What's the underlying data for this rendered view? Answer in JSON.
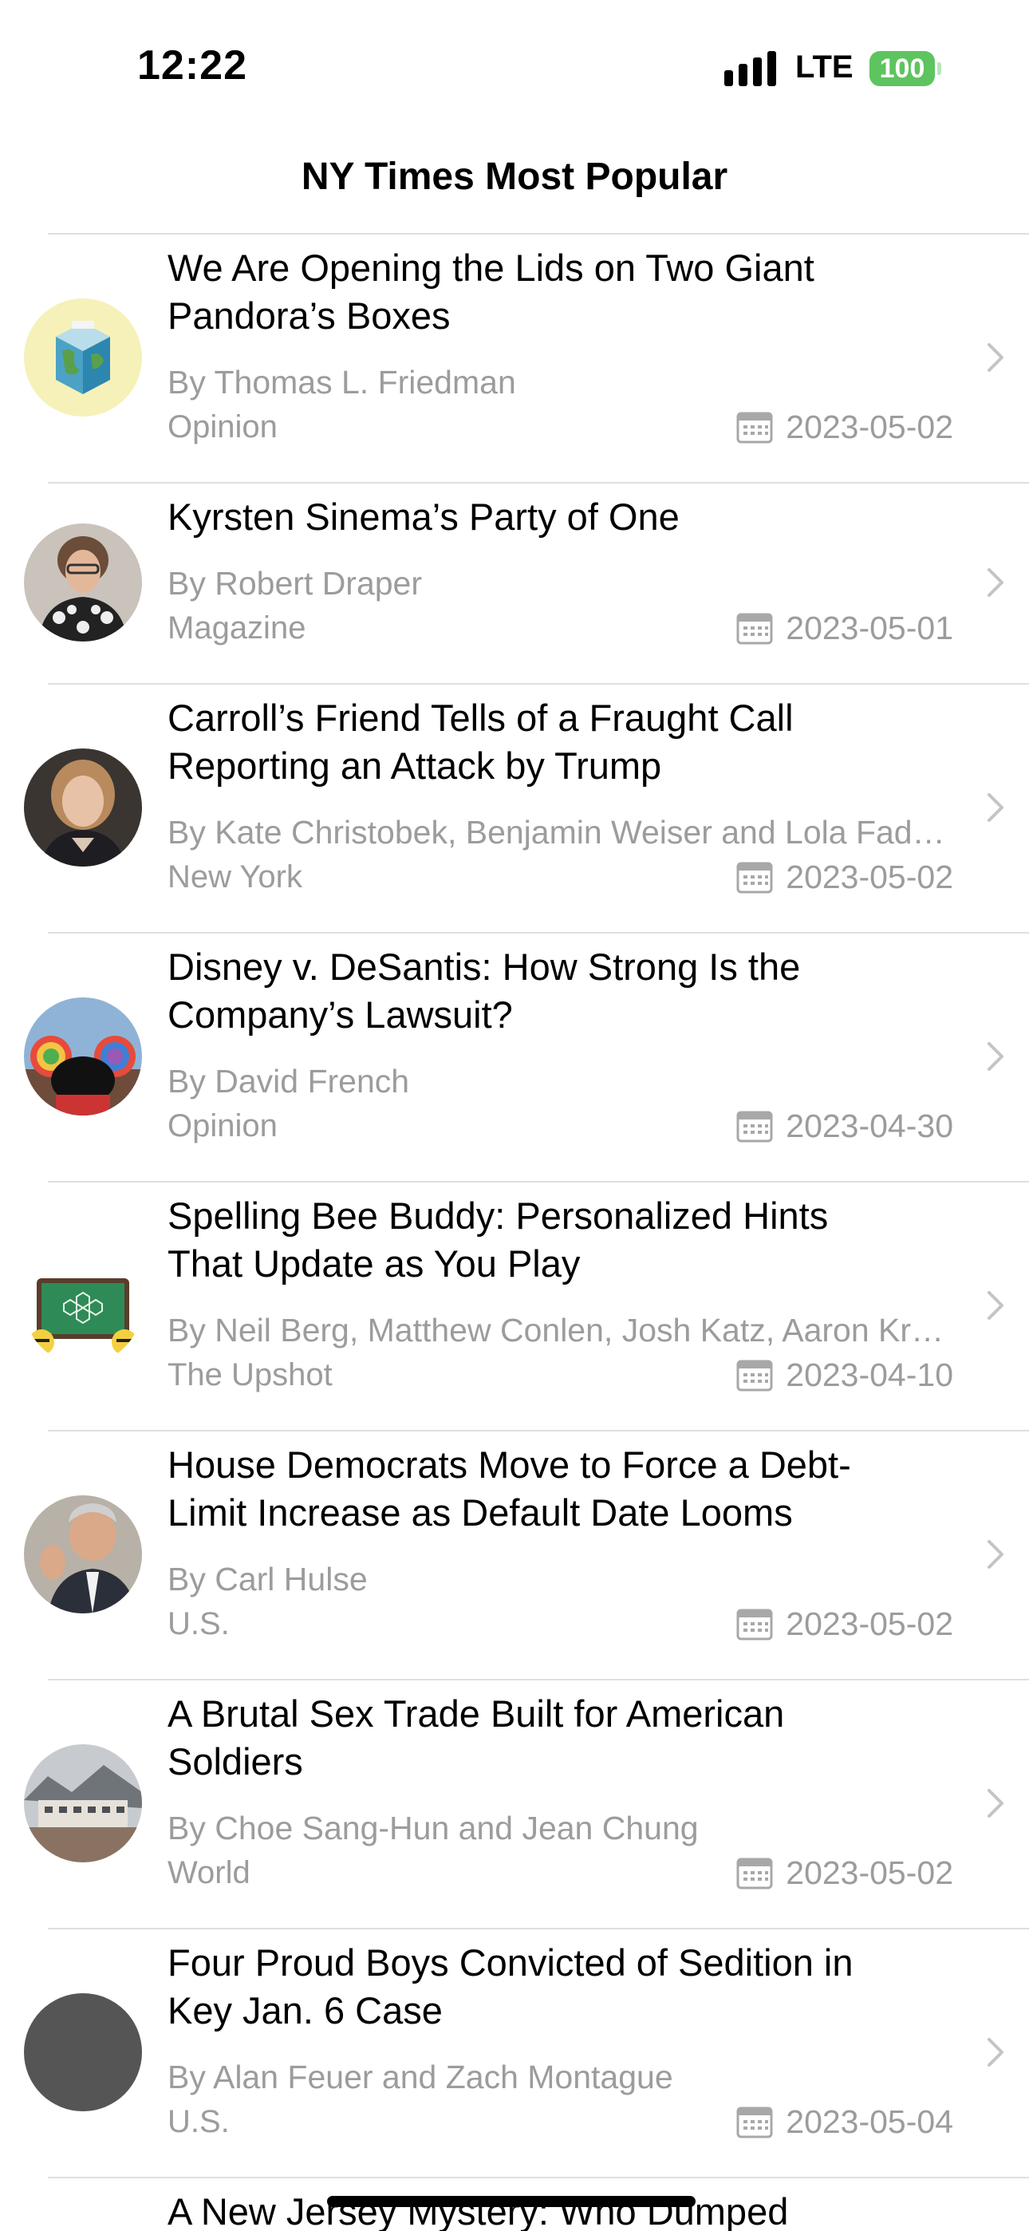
{
  "status_bar": {
    "time": "12:22",
    "network": "LTE",
    "battery": "100"
  },
  "nav": {
    "title": "NY Times Most Popular"
  },
  "colors": {
    "secondary_text": "#9c9c9e",
    "separator": "#dfdfe2",
    "battery_green": "#5dc460"
  },
  "articles": [
    {
      "title": "We Are Opening the Lids on Two Giant Pandora’s Boxes",
      "byline": "By Thomas L. Friedman",
      "section": "Opinion",
      "date": "2023-05-02",
      "thumbnail": "globe-cube-image"
    },
    {
      "title": "Kyrsten Sinema’s Party of One",
      "byline": "By Robert Draper",
      "section": "Magazine",
      "date": "2023-05-01",
      "thumbnail": "portrait-woman-glasses"
    },
    {
      "title": "Carroll’s Friend Tells of a Fraught Call Reporting an Attack by Trump",
      "byline": "By Kate Christobek, Benjamin Weiser and Lola Fadulu",
      "section": "New York",
      "date": "2023-05-02",
      "thumbnail": "portrait-woman"
    },
    {
      "title": "Disney v. DeSantis: How Strong Is the Company’s Lawsuit?",
      "byline": "By David French",
      "section": "Opinion",
      "date": "2023-04-30",
      "thumbnail": "mickey-ears-image"
    },
    {
      "title": "Spelling Bee Buddy: Personalized Hints That Update as You Play",
      "byline": "By Neil Berg, Matthew Conlen, Josh Katz, Aaron Krolik",
      "section": "The Upshot",
      "date": "2023-04-10",
      "thumbnail": "spelling-bee-board"
    },
    {
      "title": "House Democrats Move to Force a Debt-Limit Increase as Default Date Looms",
      "byline": "By Carl Hulse",
      "section": "U.S.",
      "date": "2023-05-02",
      "thumbnail": "portrait-man-speaking"
    },
    {
      "title": "A Brutal Sex Trade Built for American Soldiers",
      "byline": "By Choe Sang-Hun and Jean Chung",
      "section": "World",
      "date": "2023-05-02",
      "thumbnail": "building-landscape"
    },
    {
      "title": "Four Proud Boys Convicted of Sedition in Key Jan. 6 Case",
      "byline": "By Alan Feuer and Zach Montague",
      "section": "U.S.",
      "date": "2023-05-04",
      "thumbnail": "placeholder-gray"
    },
    {
      "title": "A New Jersey Mystery: Who Dumped",
      "byline": "",
      "section": "",
      "date": "",
      "thumbnail": ""
    }
  ]
}
